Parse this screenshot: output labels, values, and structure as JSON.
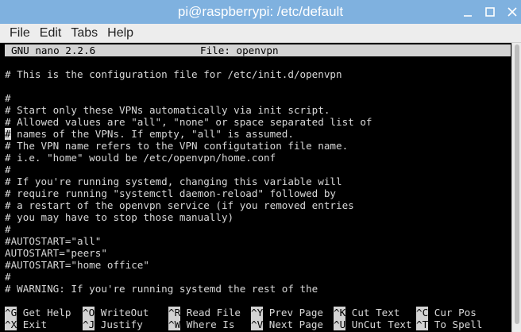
{
  "window": {
    "title": "pi@raspberrypi: /etc/default",
    "controls": [
      "minimize-icon",
      "maximize-icon",
      "close-icon"
    ]
  },
  "menu": [
    "File",
    "Edit",
    "Tabs",
    "Help"
  ],
  "nano": {
    "version": "GNU nano 2.2.6",
    "file": "File: openvpn"
  },
  "lines": [
    "# This is the configuration file for /etc/init.d/openvpn",
    "",
    "#",
    "# Start only these VPNs automatically via init script.",
    "# Allowed values are \"all\", \"none\" or space separated list of",
    "# names of the VPNs. If empty, \"all\" is assumed.",
    "# The VPN name refers to the VPN configutation file name.",
    "# i.e. \"home\" would be /etc/openvpn/home.conf",
    "#",
    "# If you're running systemd, changing this variable will",
    "# require running \"systemctl daemon-reload\" followed by",
    "# a restart of the openvpn service (if you removed entries",
    "# you may have to stop those manually)",
    "#",
    "#AUTOSTART=\"all\"",
    "AUTOSTART=\"peers\"",
    "#AUTOSTART=\"home office\"",
    "#",
    "# WARNING: If you're running systemd the rest of the"
  ],
  "cursor_line": 5,
  "shortcuts": [
    [
      {
        "key": "^G",
        "label": " Get Help"
      },
      {
        "key": "^O",
        "label": " WriteOut"
      },
      {
        "key": "^R",
        "label": " Read File"
      },
      {
        "key": "^Y",
        "label": " Prev Page"
      },
      {
        "key": "^K",
        "label": " Cut Text"
      },
      {
        "key": "^C",
        "label": " Cur Pos"
      }
    ],
    [
      {
        "key": "^X",
        "label": " Exit"
      },
      {
        "key": "^J",
        "label": " Justify"
      },
      {
        "key": "^W",
        "label": " Where Is"
      },
      {
        "key": "^V",
        "label": " Next Page"
      },
      {
        "key": "^U",
        "label": " UnCut Text"
      },
      {
        "key": "^T",
        "label": " To Spell"
      }
    ]
  ]
}
